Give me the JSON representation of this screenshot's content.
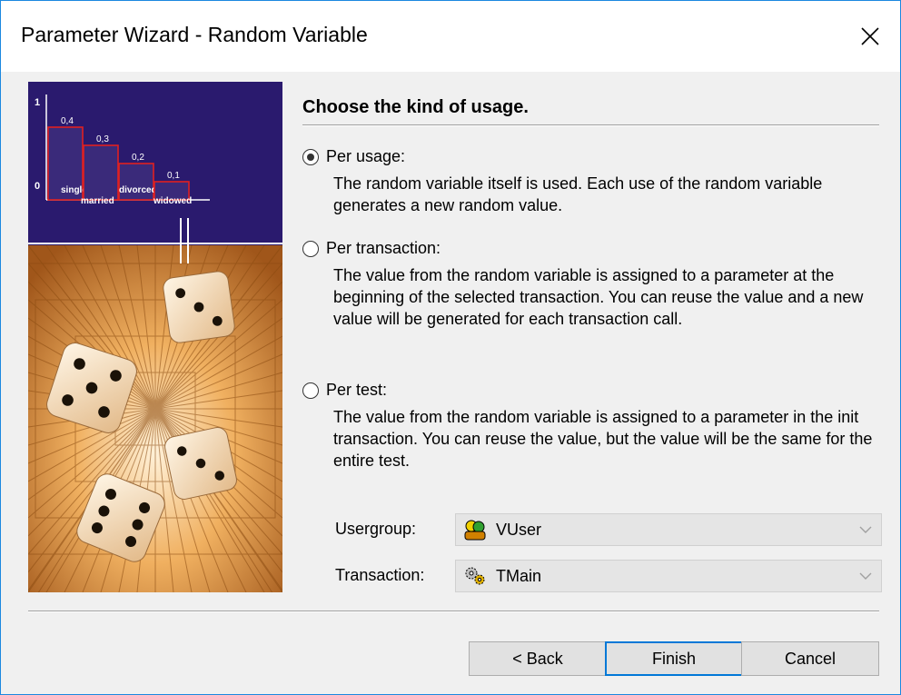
{
  "window": {
    "title": "Parameter Wizard - Random Variable"
  },
  "main": {
    "heading": "Choose the kind of usage.",
    "options": [
      {
        "label": "Per usage:",
        "checked": true,
        "description": "The random variable itself is used. Each use of the random variable generates a new random value."
      },
      {
        "label": "Per transaction:",
        "checked": false,
        "description": "The value from the random variable is assigned to a parameter at the beginning of the selected transaction. You can reuse the value and a new value will be generated for each transaction call."
      },
      {
        "label": "Per test:",
        "checked": false,
        "description": "The value from the random variable is assigned to a parameter in the init transaction. You can reuse the value, but the value will be the same for the entire test."
      }
    ],
    "usergroup": {
      "label": "Usergroup:",
      "value": "VUser",
      "icon": "users-icon"
    },
    "transaction": {
      "label": "Transaction:",
      "value": "TMain",
      "icon": "gears-icon"
    }
  },
  "art": {
    "y_max": "1",
    "y_min": "0",
    "bars": [
      {
        "value": "0,4",
        "label": "single"
      },
      {
        "value": "0,3",
        "label": "married"
      },
      {
        "value": "0,2",
        "label": "divorced"
      },
      {
        "value": "0,1",
        "label": "widowed"
      }
    ]
  },
  "buttons": {
    "back": "< Back",
    "finish": "Finish",
    "cancel": "Cancel"
  },
  "colors": {
    "accent": "#0078d7",
    "chart_bg": "#2a1a6e",
    "bar_edge": "#e02020",
    "art_orange": "#e89a3c"
  }
}
